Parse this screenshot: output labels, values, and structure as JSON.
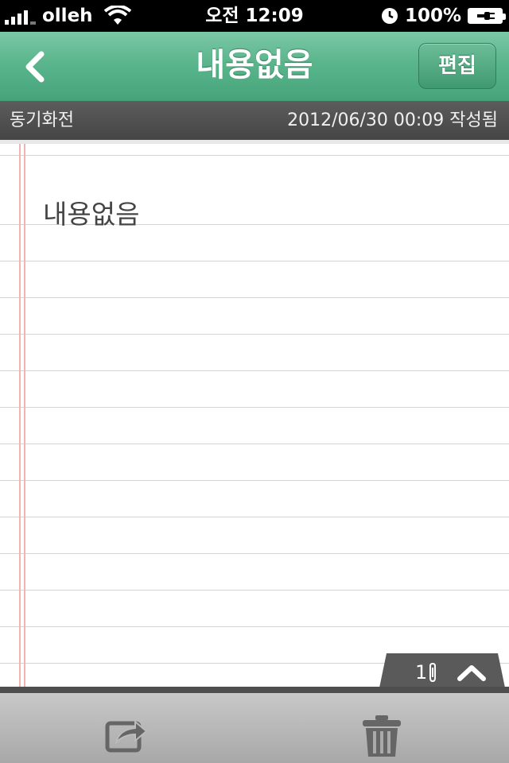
{
  "status_bar": {
    "carrier": "olleh",
    "time": "오전 12:09",
    "battery_percent": "100%"
  },
  "nav": {
    "title": "내용없음",
    "edit_label": "편집"
  },
  "info_bar": {
    "folder": "동기화전",
    "created": "2012/06/30 00:09 작성됨"
  },
  "note": {
    "text": "내용없음"
  },
  "attachment": {
    "count": "1"
  },
  "colors": {
    "nav_green": "#5ab58c",
    "info_bar": "#4f4f4f",
    "margin_line": "#f2b3b3",
    "toolbar": "#b8b8b8",
    "icon_gray": "#666666"
  },
  "icons": [
    "signal-icon",
    "wifi-icon",
    "alarm-clock-icon",
    "battery-icon",
    "back-chevron-icon",
    "paperclip-icon",
    "chevron-up-icon",
    "share-icon",
    "trash-icon"
  ]
}
